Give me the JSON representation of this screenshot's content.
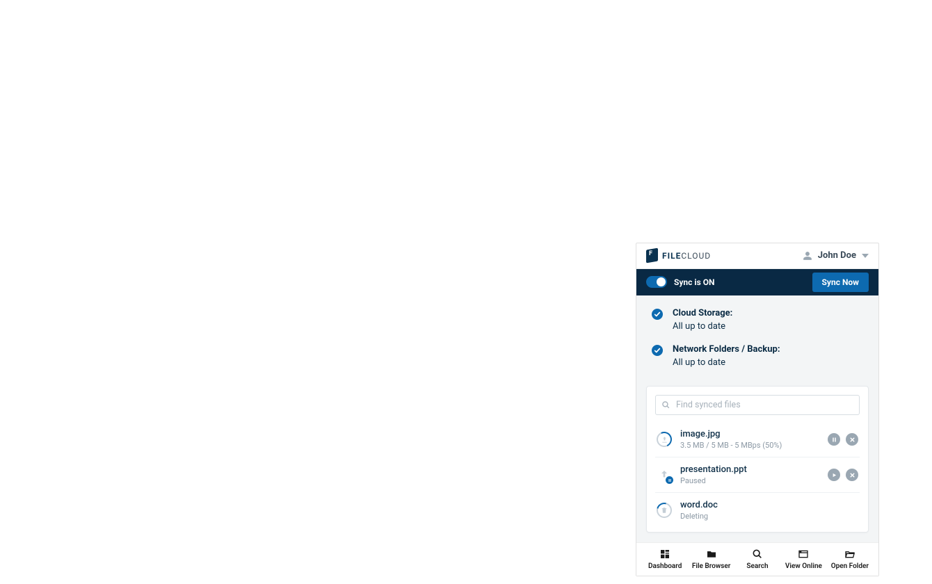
{
  "brand": {
    "name_bold": "FILE",
    "name_light": "CLOUD"
  },
  "user": {
    "name": "John Doe"
  },
  "sync": {
    "status_label": "Sync is ON",
    "button_label": "Sync Now"
  },
  "statuses": [
    {
      "title": "Cloud Storage:",
      "subtitle": "All up to date"
    },
    {
      "title": "Network Folders / Backup:",
      "subtitle": "All up to date"
    }
  ],
  "search": {
    "placeholder": "Find synced files"
  },
  "files": [
    {
      "name": "image.jpg",
      "meta": "3.5 MB / 5 MB - 5 MBps (50%)"
    },
    {
      "name": "presentation.ppt",
      "meta": "Paused"
    },
    {
      "name": "word.doc",
      "meta": "Deleting"
    }
  ],
  "nav": [
    {
      "label": "Dashboard"
    },
    {
      "label": "File Browser"
    },
    {
      "label": "Search"
    },
    {
      "label": "View Online"
    },
    {
      "label": "Open Folder"
    }
  ]
}
